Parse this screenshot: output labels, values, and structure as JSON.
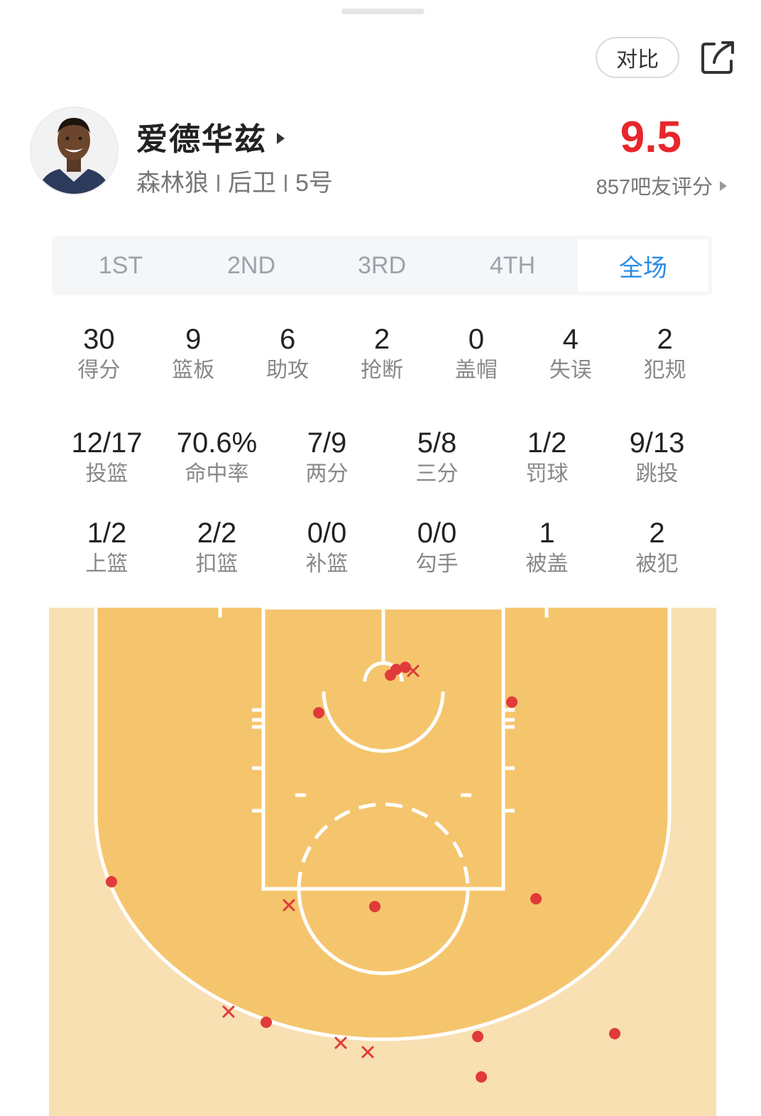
{
  "header": {
    "compare_label": "对比",
    "share_icon": "share-icon"
  },
  "player": {
    "name": "爱德华兹",
    "team": "森林狼",
    "position": "后卫",
    "number": "5号",
    "rating": "9.5",
    "rating_count_label": "857吧友评分"
  },
  "tabs": [
    {
      "label": "1ST",
      "active": false
    },
    {
      "label": "2ND",
      "active": false
    },
    {
      "label": "3RD",
      "active": false
    },
    {
      "label": "4TH",
      "active": false
    },
    {
      "label": "全场",
      "active": true
    }
  ],
  "stats_primary": [
    {
      "value": "30",
      "label": "得分"
    },
    {
      "value": "9",
      "label": "篮板"
    },
    {
      "value": "6",
      "label": "助攻"
    },
    {
      "value": "2",
      "label": "抢断"
    },
    {
      "value": "0",
      "label": "盖帽"
    },
    {
      "value": "4",
      "label": "失误"
    },
    {
      "value": "2",
      "label": "犯规"
    }
  ],
  "stats_shooting": [
    {
      "value": "12/17",
      "label": "投篮"
    },
    {
      "value": "70.6%",
      "label": "命中率"
    },
    {
      "value": "7/9",
      "label": "两分"
    },
    {
      "value": "5/8",
      "label": "三分"
    },
    {
      "value": "1/2",
      "label": "罚球"
    },
    {
      "value": "9/13",
      "label": "跳投"
    }
  ],
  "stats_shot_types": [
    {
      "value": "1/2",
      "label": "上篮"
    },
    {
      "value": "2/2",
      "label": "扣篮"
    },
    {
      "value": "0/0",
      "label": "补篮"
    },
    {
      "value": "0/0",
      "label": "勾手"
    },
    {
      "value": "1",
      "label": "被盖"
    },
    {
      "value": "2",
      "label": "被犯"
    }
  ],
  "colors": {
    "accent": "#2a8de6",
    "rating": "#e8262b",
    "court_inner": "#f5c56d",
    "court_outer": "#f8e0b3",
    "made_shot": "#e03a3a",
    "missed_shot": "#e03a3a"
  }
}
